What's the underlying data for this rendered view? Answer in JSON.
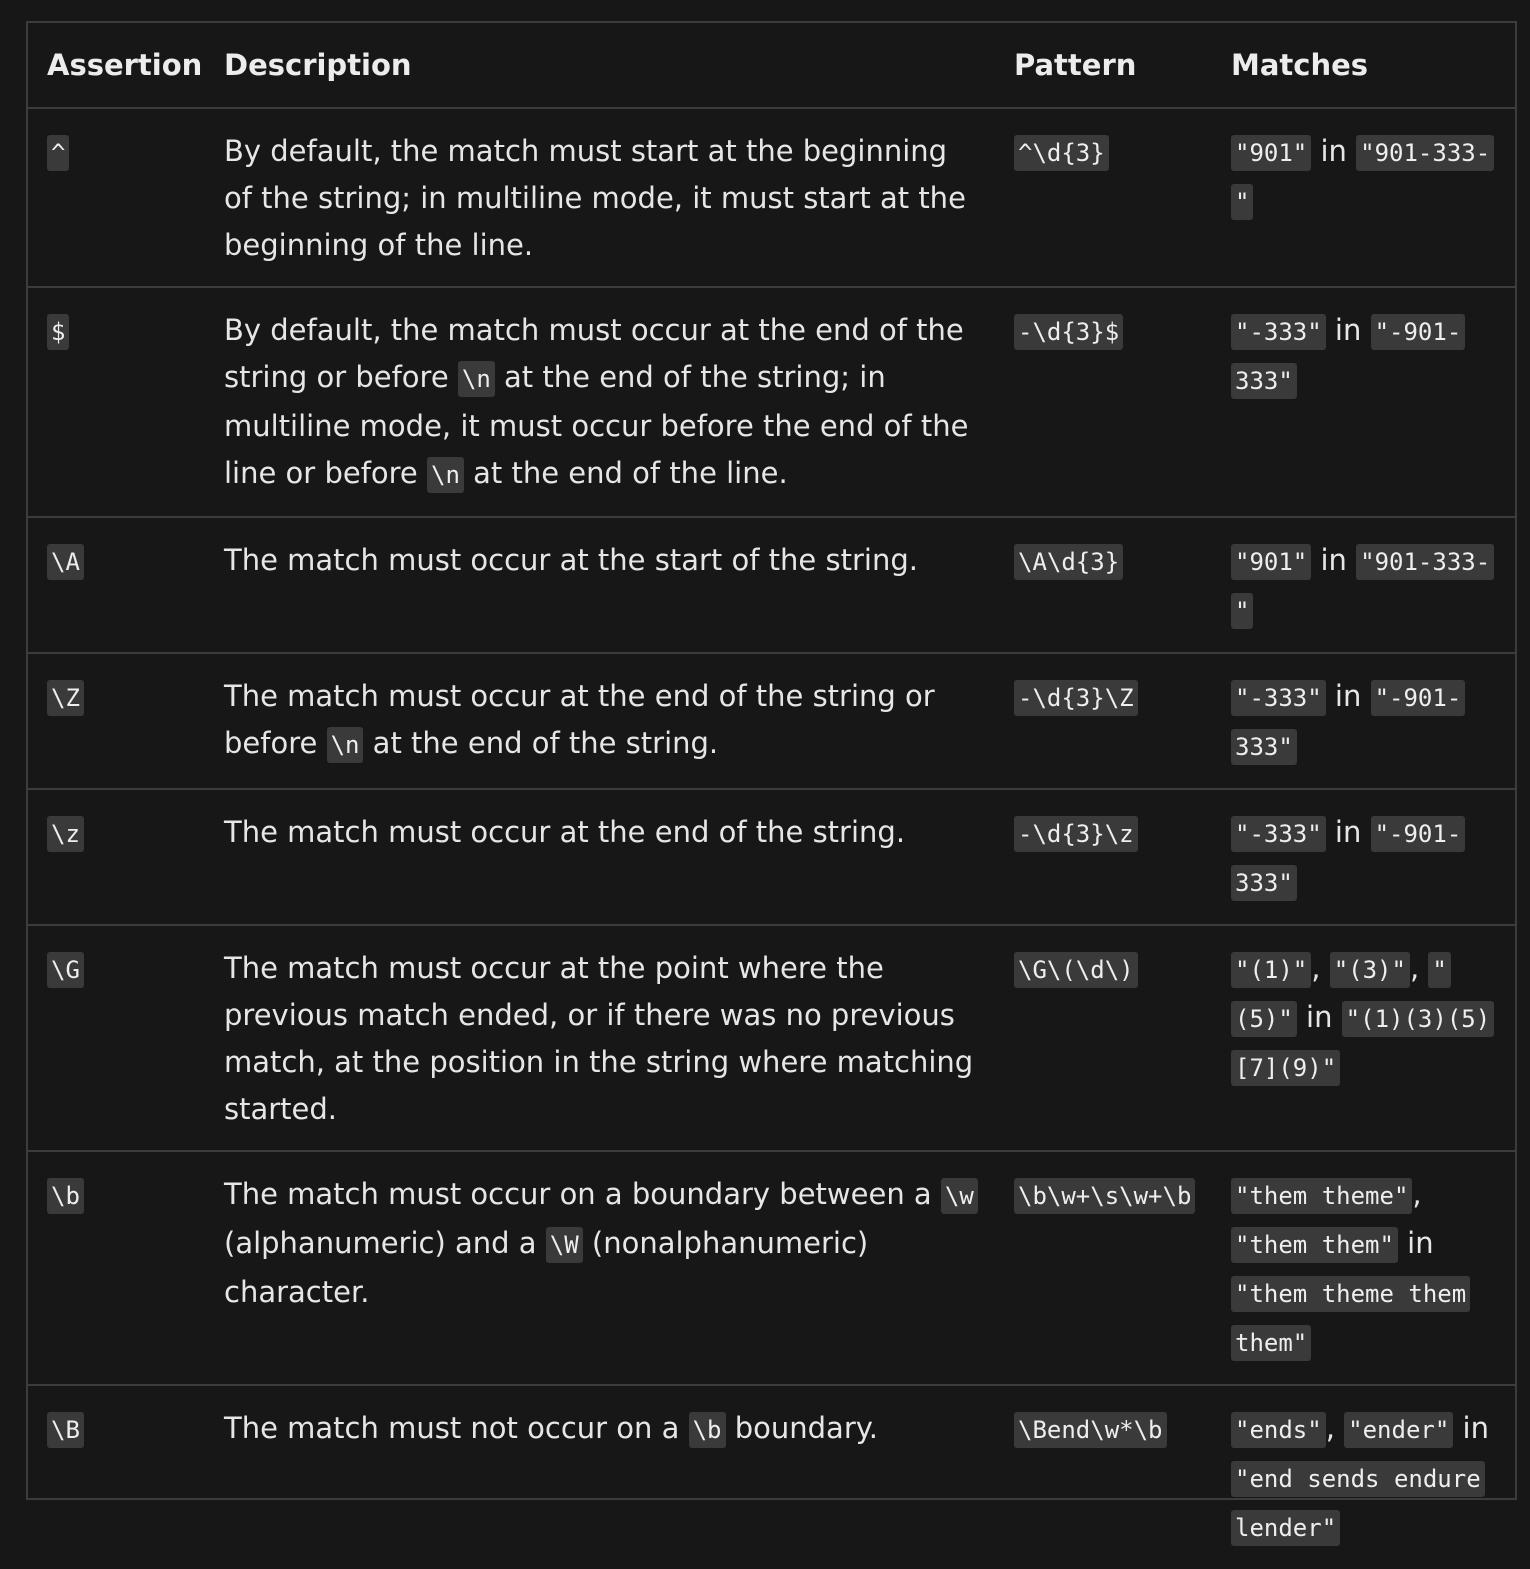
{
  "headers": {
    "assertion": "Assertion",
    "description": "Description",
    "pattern": "Pattern",
    "matches": "Matches"
  },
  "rows": [
    {
      "assertion": "^",
      "description": [
        {
          "t": "By default, the match must start at the beginning of the string; in multiline mode, it must start at the beginning of the line."
        }
      ],
      "pattern": "^\\d{3}",
      "matches": [
        {
          "c": "\"901\""
        },
        {
          "t": " in "
        },
        {
          "c": "\"901-333-\""
        }
      ]
    },
    {
      "assertion": "$",
      "description": [
        {
          "t": "By default, the match must occur at the end of the string or before "
        },
        {
          "c": "\\n"
        },
        {
          "t": " at the end of the string; in multiline mode, it must occur before the end of the line or before "
        },
        {
          "c": "\\n"
        },
        {
          "t": " at the end of the line."
        }
      ],
      "pattern": "-\\d{3}$",
      "matches": [
        {
          "c": "\"-333\""
        },
        {
          "t": " in "
        },
        {
          "c": "\"-901-333\""
        }
      ]
    },
    {
      "assertion": "\\A",
      "description": [
        {
          "t": "The match must occur at the start of the string."
        }
      ],
      "pattern": "\\A\\d{3}",
      "matches": [
        {
          "c": "\"901\""
        },
        {
          "t": " in "
        },
        {
          "c": "\"901-333-\""
        }
      ]
    },
    {
      "assertion": "\\Z",
      "description": [
        {
          "t": "The match must occur at the end of the string or before "
        },
        {
          "c": "\\n"
        },
        {
          "t": " at the end of the string."
        }
      ],
      "pattern": "-\\d{3}\\Z",
      "matches": [
        {
          "c": "\"-333\""
        },
        {
          "t": " in "
        },
        {
          "c": "\"-901-333\""
        }
      ]
    },
    {
      "assertion": "\\z",
      "description": [
        {
          "t": "The match must occur at the end of the string."
        }
      ],
      "pattern": "-\\d{3}\\z",
      "matches": [
        {
          "c": "\"-333\""
        },
        {
          "t": " in "
        },
        {
          "c": "\"-901-333\""
        }
      ]
    },
    {
      "assertion": "\\G",
      "description": [
        {
          "t": "The match must occur at the point where the previous match ended, or if there was no previous match, at the position in the string where matching started."
        }
      ],
      "pattern": "\\G\\(\\d\\)",
      "matches": [
        {
          "c": "\"(1)\""
        },
        {
          "t": ", "
        },
        {
          "c": "\"(3)\""
        },
        {
          "t": ", "
        },
        {
          "c": "\"(5)\""
        },
        {
          "t": " in "
        },
        {
          "c": "\"(1)(3)(5)[7](9)\""
        }
      ]
    },
    {
      "assertion": "\\b",
      "description": [
        {
          "t": "The match must occur on a boundary between a "
        },
        {
          "c": "\\w"
        },
        {
          "t": " (alphanumeric) and a "
        },
        {
          "c": "\\W"
        },
        {
          "t": " (nonalphanumeric) character."
        }
      ],
      "pattern": "\\b\\w+\\s\\w+\\b",
      "matches": [
        {
          "c": "\"them theme\""
        },
        {
          "t": ", "
        },
        {
          "c": "\"them them\""
        },
        {
          "t": " in "
        },
        {
          "c": "\"them theme them them\""
        }
      ]
    },
    {
      "assertion": "\\B",
      "description": [
        {
          "t": "The match must not occur on a "
        },
        {
          "c": "\\b"
        },
        {
          "t": " boundary."
        }
      ],
      "pattern": "\\Bend\\w*\\b",
      "matches": [
        {
          "c": "\"ends\""
        },
        {
          "t": ", "
        },
        {
          "c": "\"ender\""
        },
        {
          "t": " in "
        },
        {
          "c": "\"end sends endure lender\""
        }
      ]
    }
  ]
}
